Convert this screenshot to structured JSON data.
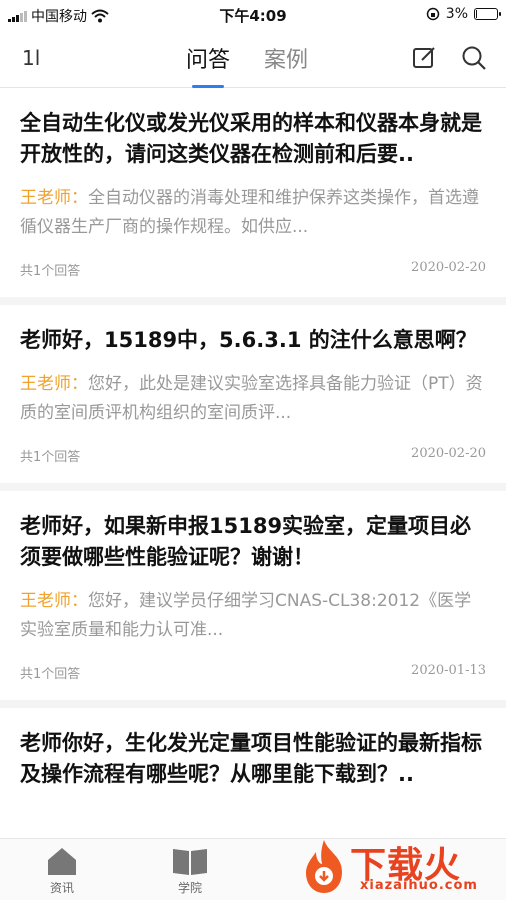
{
  "status_bar": {
    "carrier": "中国移动",
    "time": "下午4:09",
    "battery_percent": "3%",
    "battery_level": 0.03
  },
  "nav": {
    "sort_label": "1l",
    "tabs": [
      {
        "label": "问答",
        "active": true
      },
      {
        "label": "案例",
        "active": false
      }
    ]
  },
  "questions": [
    {
      "title": "全自动生化仪或发光仪采用的样本和仪器本身就是开放性的，请问这类仪器在检测前和后要..",
      "teacher": "王老师：",
      "answer": "全自动仪器的消毒处理和维护保养这类操作，首选遵循仪器生产厂商的操作规程。如供应...",
      "count": "共1个回答",
      "date": "2020-02-20"
    },
    {
      "title": "老师好，15189中，5.6.3.1 的注什么意思啊？",
      "teacher": "王老师：",
      "answer": "您好，此处是建议实验室选择具备能力验证（PT）资质的室间质评机构组织的室间质评...",
      "count": "共1个回答",
      "date": "2020-02-20"
    },
    {
      "title": "老师好，如果新申报15189实验室，定量项目必须要做哪些性能验证呢？谢谢！",
      "teacher": "王老师：",
      "answer": "您好，建议学员仔细学习CNAS-CL38:2012《医学实验室质量和能力认可准...",
      "count": "共1个回答",
      "date": "2020-01-13"
    },
    {
      "title": "老师你好，生化发光定量项目性能验证的最新指标及操作流程有哪些呢？从哪里能下载到？..",
      "teacher": "",
      "answer": "",
      "count": "",
      "date": ""
    }
  ],
  "bottom_bar": {
    "items": [
      {
        "label": "资讯",
        "icon": "home-icon"
      },
      {
        "label": "学院",
        "icon": "book-icon"
      }
    ]
  },
  "watermark": {
    "text": "下载火",
    "sub": "xiazaihuo.com"
  }
}
